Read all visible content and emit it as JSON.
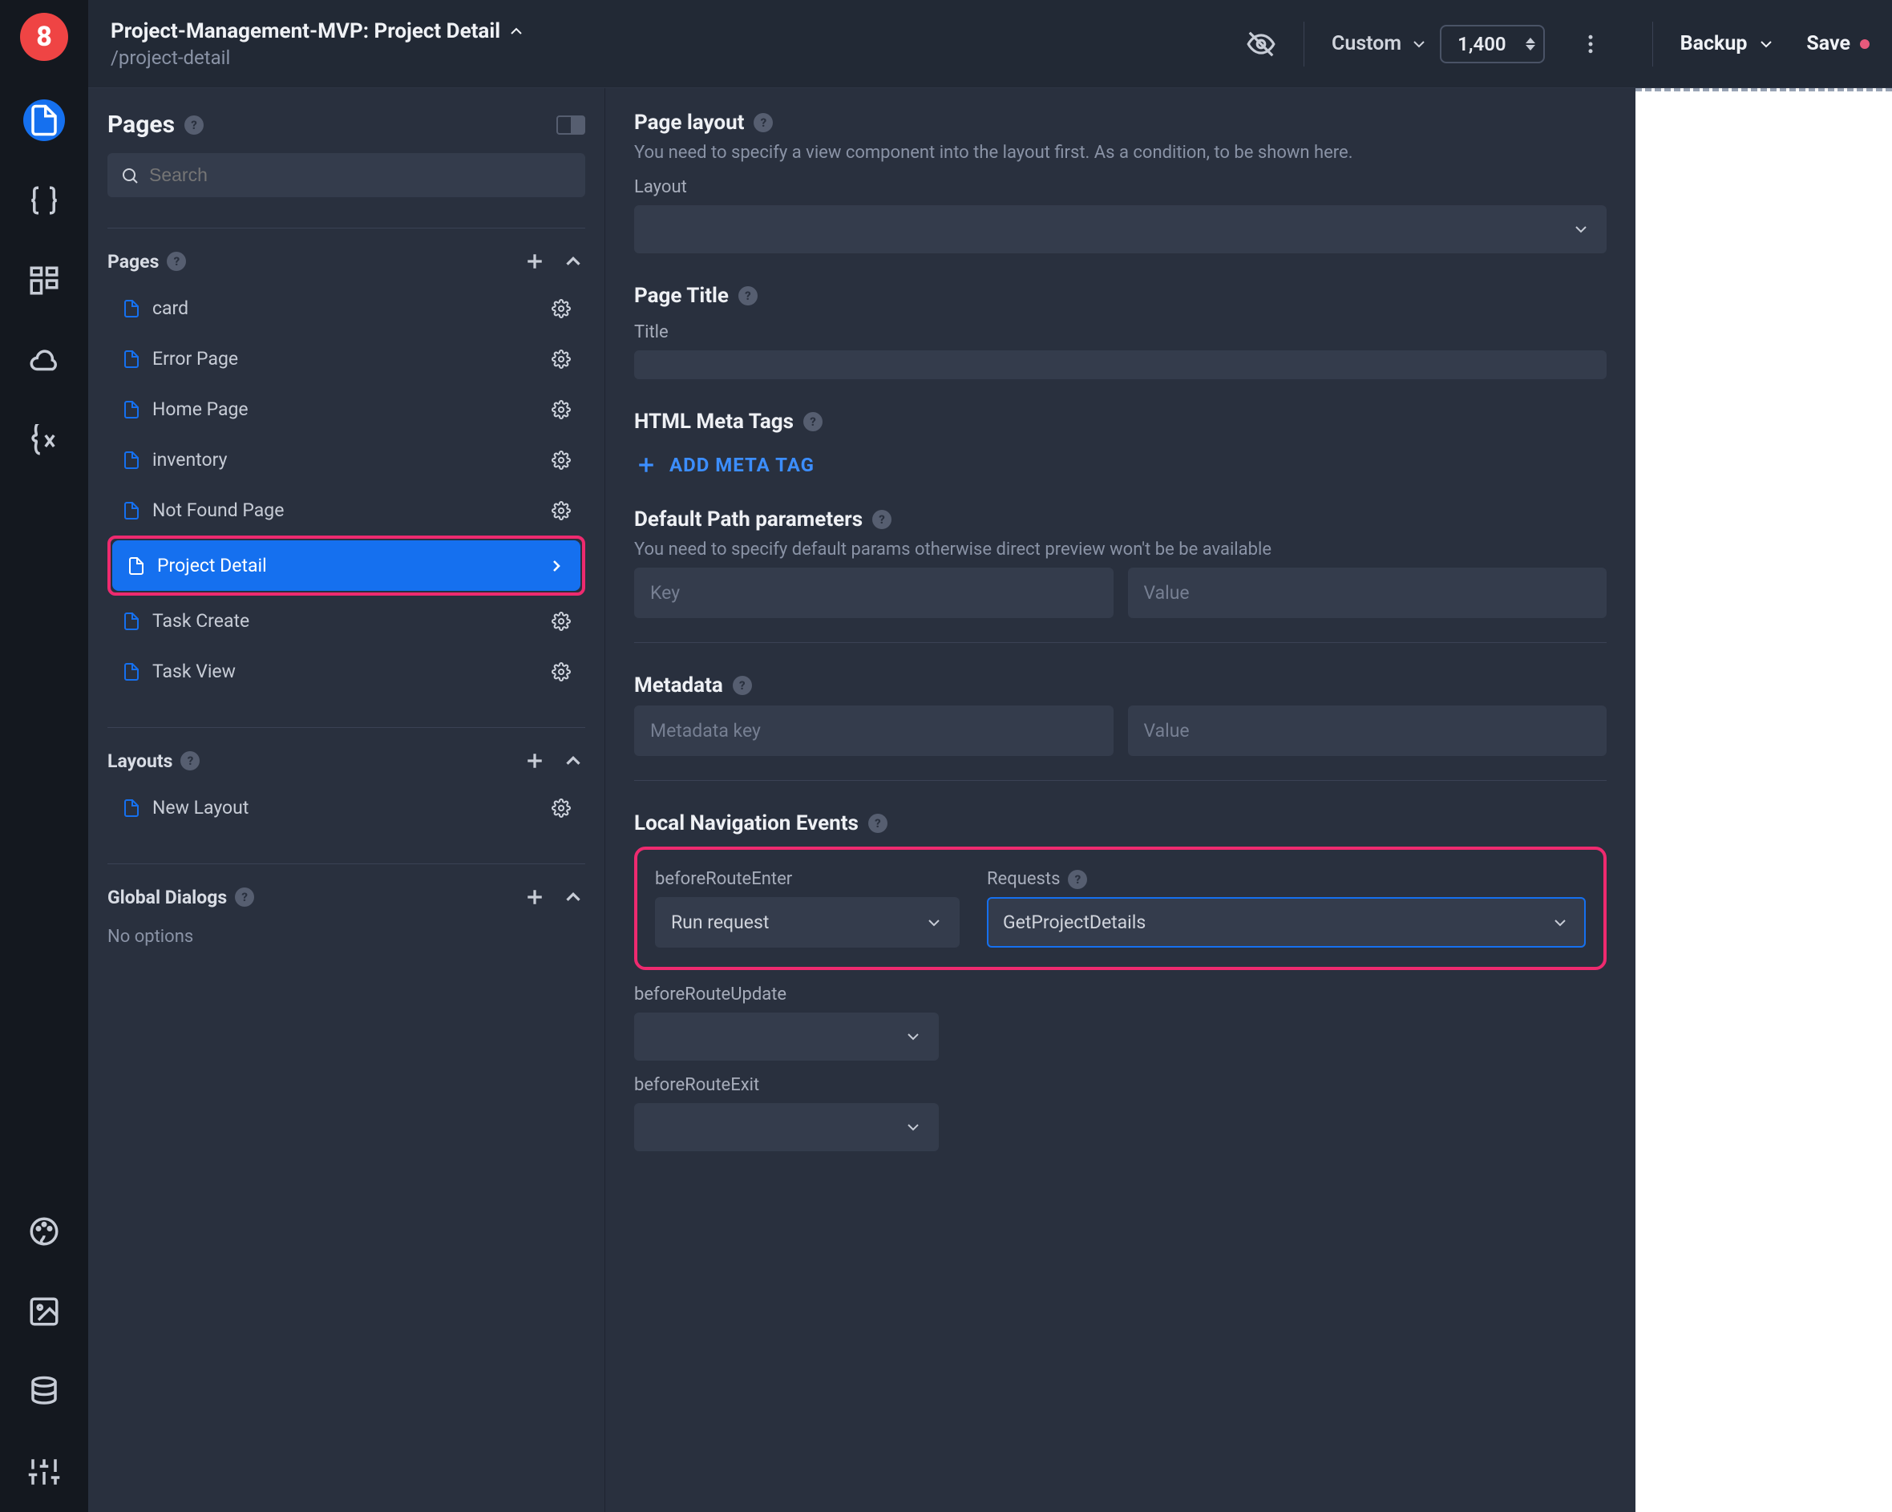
{
  "topbar": {
    "project_title": "Project-Management-MVP: Project Detail",
    "project_path": "/project-detail",
    "zoom_mode": "Custom",
    "zoom_value": "1,400",
    "backup_label": "Backup",
    "save_label": "Save"
  },
  "pages_panel": {
    "title": "Pages",
    "search_placeholder": "Search",
    "pages_section_label": "Pages",
    "layouts_section_label": "Layouts",
    "dialogs_section_label": "Global Dialogs",
    "no_options_label": "No options",
    "pages": [
      {
        "label": "card"
      },
      {
        "label": "Error Page"
      },
      {
        "label": "Home Page"
      },
      {
        "label": "inventory"
      },
      {
        "label": "Not Found Page"
      },
      {
        "label": "Project Detail",
        "selected": true
      },
      {
        "label": "Task Create"
      },
      {
        "label": "Task View"
      }
    ],
    "layouts": [
      {
        "label": "New Layout"
      }
    ]
  },
  "settings": {
    "page_layout": {
      "title": "Page layout",
      "desc": "You need to specify a view component into the layout first. As a condition, to be shown here.",
      "label": "Layout",
      "value": ""
    },
    "page_title": {
      "title": "Page Title",
      "label": "Title",
      "value": ""
    },
    "meta": {
      "title": "HTML Meta Tags",
      "add_label": "ADD META TAG"
    },
    "path_params": {
      "title": "Default Path parameters",
      "desc": "You need to specify default params otherwise direct preview won't be be available",
      "key_placeholder": "Key",
      "value_placeholder": "Value"
    },
    "metadata": {
      "title": "Metadata",
      "key_placeholder": "Metadata key",
      "value_placeholder": "Value"
    },
    "nav_events": {
      "title": "Local Navigation Events",
      "before_enter_label": "beforeRouteEnter",
      "before_enter_value": "Run request",
      "requests_label": "Requests",
      "requests_value": "GetProjectDetails",
      "before_update_label": "beforeRouteUpdate",
      "before_update_value": "",
      "before_exit_label": "beforeRouteExit",
      "before_exit_value": ""
    }
  }
}
